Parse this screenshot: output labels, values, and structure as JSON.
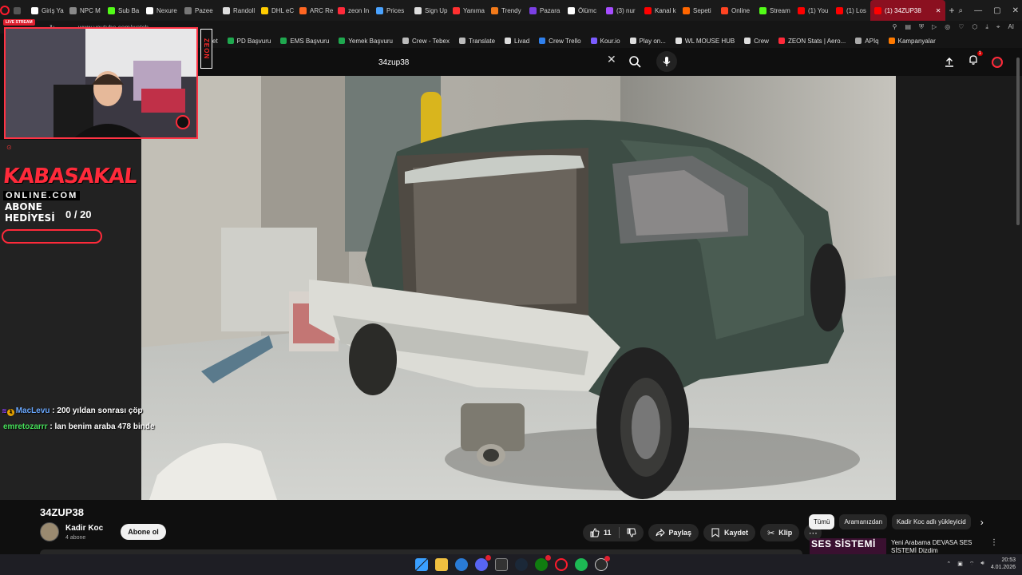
{
  "browser": {
    "tabs": [
      {
        "label": "Giriş Ya",
        "color": "#ffffff"
      },
      {
        "label": "NPC M",
        "color": "#888888"
      },
      {
        "label": "Sub Ba",
        "color": "#53fc18"
      },
      {
        "label": "Nexure",
        "color": "#ffffff"
      },
      {
        "label": "Pazee",
        "color": "#777777"
      },
      {
        "label": "Randoll",
        "color": "#dddddd"
      },
      {
        "label": "DHL eC",
        "color": "#ffcc00"
      },
      {
        "label": "ARC Re",
        "color": "#ff6622"
      },
      {
        "label": "zeon In",
        "color": "#ff2a3a"
      },
      {
        "label": "Prices",
        "color": "#4aa3ff"
      },
      {
        "label": "Sign Up",
        "color": "#dddddd"
      },
      {
        "label": "Yanıma",
        "color": "#ff3030"
      },
      {
        "label": "Trendy",
        "color": "#f27a1a"
      },
      {
        "label": "Pazara",
        "color": "#7b3fe4"
      },
      {
        "label": "Ölümc",
        "color": "#ffffff"
      },
      {
        "label": "(3) nur",
        "color": "#a64dff"
      },
      {
        "label": "Kanal k",
        "color": "#ff0000"
      },
      {
        "label": "Sepeti",
        "color": "#ff6600"
      },
      {
        "label": "Online",
        "color": "#ff4422"
      },
      {
        "label": "Stream",
        "color": "#53fc18"
      },
      {
        "label": "(1) You",
        "color": "#ff0000"
      },
      {
        "label": "(1) Los",
        "color": "#ff0000"
      }
    ],
    "active_tab": "(1) 34ZUP38",
    "new_tab": "+",
    "url": "www.youtube.com/watch",
    "bookmarks": [
      {
        "label": "et",
        "color": "#999999"
      },
      {
        "label": "PD Başvuru",
        "color": "#1fa84f"
      },
      {
        "label": "EMS Başvuru",
        "color": "#1fa84f"
      },
      {
        "label": "Yemek Başvuru",
        "color": "#1fa84f"
      },
      {
        "label": "Crew - Tebex",
        "color": "#bbbbbb"
      },
      {
        "label": "Translate",
        "color": "#bbbbbb"
      },
      {
        "label": "Livad",
        "color": "#dddddd"
      },
      {
        "label": "Crew Trello",
        "color": "#2f80ed"
      },
      {
        "label": "Kour.io",
        "color": "#7b5cff"
      },
      {
        "label": "Play on...",
        "color": "#dddddd"
      },
      {
        "label": "WL MOUSE HUB",
        "color": "#e0e0e0"
      },
      {
        "label": "Crew",
        "color": "#dddddd"
      },
      {
        "label": "ZEON Stats | Aero...",
        "color": "#ff2a3a"
      },
      {
        "label": "APIq",
        "color": "#aaaaaa"
      },
      {
        "label": "Kampanyalar",
        "color": "#ff7a00"
      }
    ]
  },
  "youtube": {
    "search_query": "34zup38",
    "notification_count": "1",
    "video_title": "34ZUP38",
    "channel_name": "Kadir Koc",
    "subscribers": "4 abone",
    "subscribe_label": "Abone ol",
    "likes": "11",
    "share_label": "Paylaş",
    "save_label": "Kaydet",
    "clip_label": "Klip",
    "chips": [
      "Tümü",
      "Aramanızdan",
      "Kadir Koc adlı yükleyicid"
    ],
    "recommended": {
      "thumb_text": "SES SİSTEMİ",
      "title": "Yeni Arabama DEVASA SES SİSTEMİ Dizdim"
    }
  },
  "stream_overlay": {
    "live_tag": "LIVE STREAM",
    "zeon_badge": "ZEON",
    "brand": "KABASAKAL",
    "brand_sub": "ONLINE.COM",
    "sub_goal_label_1": "ABONE",
    "sub_goal_label_2": "HEDİYESİ",
    "sub_goal_count": "0  / 20",
    "sub_goal_progress": 0
  },
  "chat": [
    {
      "user": "MacLevu",
      "badge": "1",
      "message": ": 200 yıldan sonrası çöp"
    },
    {
      "user": "emretozarrr",
      "badge": "",
      "message": ": lan benim araba 478 binde"
    }
  ],
  "taskbar": {
    "time": "20:53",
    "date": "4.01.2026"
  },
  "colors": {
    "accent": "#ff2a3a",
    "youtube_bg": "#0f0f0f",
    "pill_bg": "#272727"
  }
}
